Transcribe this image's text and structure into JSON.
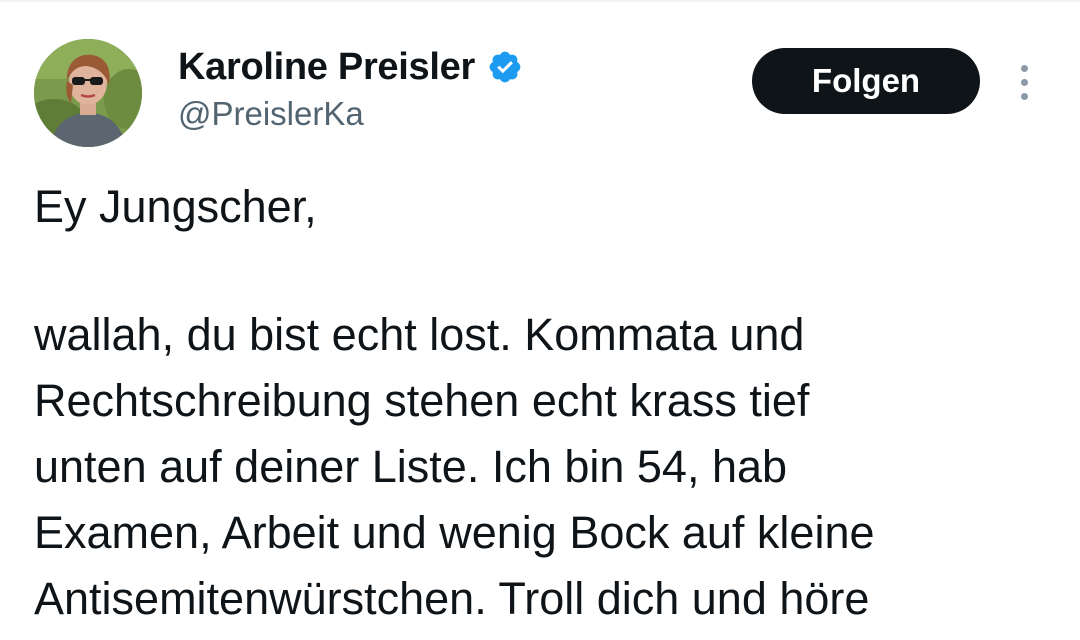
{
  "tweet": {
    "author": {
      "display_name": "Karoline Preisler",
      "handle": "@PreislerKa",
      "verified": true,
      "avatar_icon": "profile-photo-woman-sunglasses"
    },
    "follow_label": "Folgen",
    "text_lines": [
      "Ey Jungscher,",
      "",
      "wallah, du bist echt lost. Kommata und",
      "Rechtschreibung stehen echt krass tief",
      "unten auf deiner Liste. Ich bin 54, hab",
      "Examen, Arbeit und wenig Bock auf kleine",
      "Antisemitenwürstchen. Troll dich und höre"
    ]
  },
  "icons": {
    "verified_badge": "verified-badge-icon",
    "more_options": "more-options-icon"
  },
  "colors": {
    "text_primary": "#0f1419",
    "text_secondary": "#536471",
    "verified_blue": "#1d9bf0",
    "button_bg": "#0f1419",
    "button_text": "#ffffff",
    "more_dots": "#8b98a5"
  }
}
